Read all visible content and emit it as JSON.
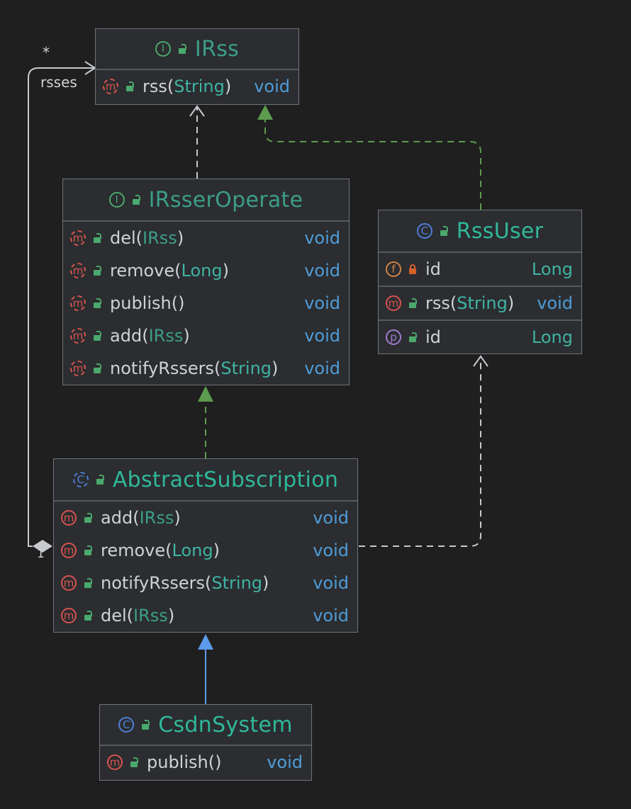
{
  "nodes": {
    "irss": {
      "name": "IRss",
      "kind_badge": "I",
      "methods": [
        {
          "name": "rss",
          "params": [
            {
              "text": "String",
              "iface": false
            }
          ],
          "return": "void"
        }
      ]
    },
    "irsser_operate": {
      "name": "IRsserOperate",
      "kind_badge": "I",
      "methods": [
        {
          "name": "del",
          "params": [
            {
              "text": "IRss",
              "iface": true
            }
          ],
          "return": "void"
        },
        {
          "name": "remove",
          "params": [
            {
              "text": "Long",
              "iface": false
            }
          ],
          "return": "void"
        },
        {
          "name": "publish",
          "params": [],
          "return": "void"
        },
        {
          "name": "add",
          "params": [
            {
              "text": "IRss",
              "iface": true
            }
          ],
          "return": "void"
        },
        {
          "name": "notifyRssers",
          "params": [
            {
              "text": "String",
              "iface": false
            }
          ],
          "return": "void"
        }
      ]
    },
    "rss_user": {
      "name": "RssUser",
      "kind_badge": "C",
      "fields": [
        {
          "badge": "f",
          "name": "id",
          "type": "Long"
        }
      ],
      "methods": [
        {
          "name": "rss",
          "params": [
            {
              "text": "String",
              "iface": false
            }
          ],
          "return": "void"
        }
      ],
      "properties": [
        {
          "badge": "p",
          "name": "id",
          "type": "Long"
        }
      ]
    },
    "abstract_subscription": {
      "name": "AbstractSubscription",
      "kind_badge": "C",
      "methods": [
        {
          "name": "add",
          "params": [
            {
              "text": "IRss",
              "iface": true
            }
          ],
          "return": "void"
        },
        {
          "name": "remove",
          "params": [
            {
              "text": "Long",
              "iface": false
            }
          ],
          "return": "void"
        },
        {
          "name": "notifyRssers",
          "params": [
            {
              "text": "String",
              "iface": false
            }
          ],
          "return": "void"
        },
        {
          "name": "del",
          "params": [
            {
              "text": "IRss",
              "iface": true
            }
          ],
          "return": "void"
        }
      ]
    },
    "csdn_system": {
      "name": "CsdnSystem",
      "kind_badge": "C",
      "methods": [
        {
          "name": "publish",
          "params": [],
          "return": "void"
        }
      ]
    }
  },
  "method_badge": "m",
  "association": {
    "label": "rsses",
    "multiplicity_target": "*",
    "multiplicity_source": "1"
  },
  "colors": {
    "background": "#1f1f1f",
    "realization_arrow": "#5d9b4e",
    "inheritance_arrow": "#5b9bea",
    "dependency_arrow": "#c8cacd"
  }
}
